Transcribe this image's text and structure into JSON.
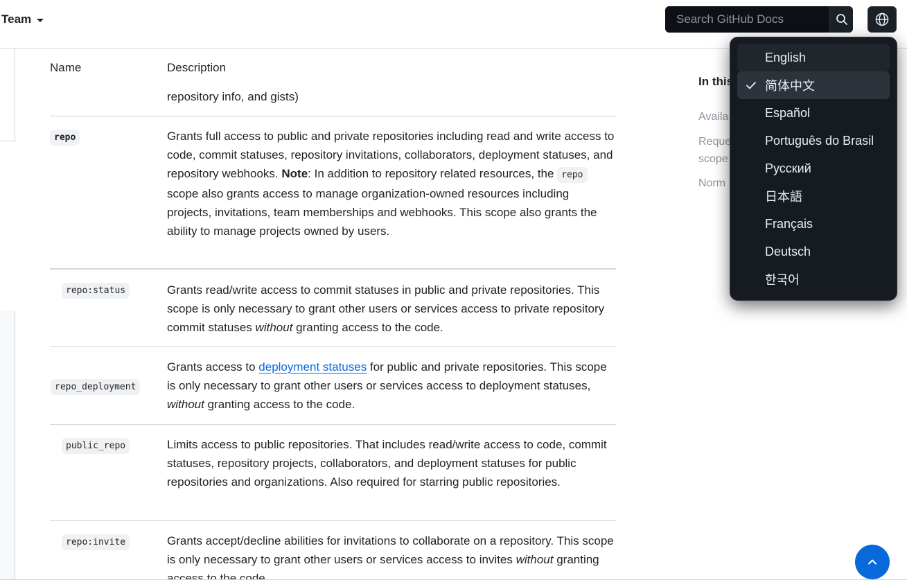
{
  "header": {
    "version_label": "Team",
    "search_placeholder": "Search GitHub Docs"
  },
  "table": {
    "headers": {
      "name": "Name",
      "description": "Description"
    },
    "continued_text": "repository info, and gists)",
    "rows": [
      {
        "name": "repo",
        "desc_1": "Grants full access to public and private repositories including read and write access to code, commit statuses, repository invitations, collaborators, deployment statuses, and repository webhooks. ",
        "note_label": "Note",
        "desc_2": ": In addition to repository related resources, the ",
        "inline_code": "repo",
        "desc_3": " scope also grants access to manage organization-owned resources including projects, invitations, team memberships and webhooks. This scope also grants the ability to manage projects owned by users."
      },
      {
        "name": "repo:status",
        "desc_1": "Grants read/write access to commit statuses in public and private repositories. This scope is only necessary to grant other users or services access to private repository commit statuses ",
        "emphasis": "without",
        "desc_2": " granting access to the code."
      },
      {
        "name": "repo_deployment",
        "desc_1": "Grants access to ",
        "link": "deployment statuses",
        "desc_2": " for public and private repositories. This scope is only necessary to grant other users or services access to deployment statuses, ",
        "emphasis": "without",
        "desc_3": " granting access to the code."
      },
      {
        "name": "public_repo",
        "desc_1": "Limits access to public repositories. That includes read/write access to code, commit statuses, repository projects, collaborators, and deployment statuses for public repositories and organizations. Also required for starring public repositories."
      },
      {
        "name": "repo:invite",
        "desc_1": "Grants accept/decline abilities for invitations to collaborate on a repository. This scope is only necessary to grant other users or services access to invites ",
        "emphasis": "without",
        "desc_2": " granting access to the code."
      }
    ]
  },
  "toc": {
    "title": "In this",
    "items": [
      "Availa",
      "Reque",
      "scope",
      "Norm"
    ]
  },
  "language_menu": {
    "items": [
      "English",
      "简体中文",
      "Español",
      "Português do Brasil",
      "Русский",
      "日本語",
      "Français",
      "Deutsch",
      "한국어"
    ],
    "selected": "简体中文"
  },
  "colors": {
    "accent": "#0969da",
    "menu_bg": "#161b22",
    "border": "#d0d7de"
  },
  "icons": [
    "chevron-down-icon",
    "search-icon",
    "globe-icon",
    "check-icon",
    "chevron-up-icon"
  ]
}
